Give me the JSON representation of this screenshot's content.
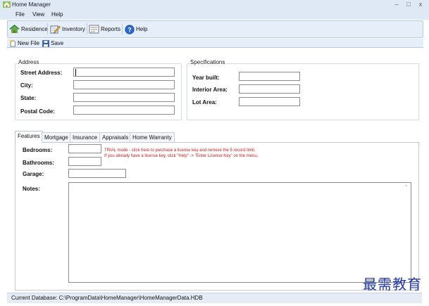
{
  "window": {
    "title": "Home Manager",
    "minimize_glyph": "–",
    "maximize_glyph": "□",
    "close_glyph": "x"
  },
  "menu": {
    "file": "File",
    "view": "View",
    "help": "Help"
  },
  "toolbar": {
    "residence": "Residence",
    "inventory": "Inventory",
    "reports": "Reports",
    "help": "Help"
  },
  "filebar": {
    "new_file": "New File",
    "save": "Save"
  },
  "address": {
    "group_title": "Address",
    "street_label": "Street Address:",
    "city_label": "City:",
    "state_label": "State:",
    "postal_label": "Postal Code:",
    "street_value": "",
    "city_value": "",
    "state_value": "",
    "postal_value": ""
  },
  "specifications": {
    "group_title": "Specifications",
    "year_label": "Year built:",
    "interior_label": "Interior Area:",
    "lot_label": "Lot Area:",
    "year_value": "",
    "interior_value": "",
    "lot_value": ""
  },
  "tabs": [
    {
      "label": "Features",
      "active": true
    },
    {
      "label": "Mortgage",
      "active": false
    },
    {
      "label": "Insurance",
      "active": false
    },
    {
      "label": "Appraisals",
      "active": false
    },
    {
      "label": "Home Warranty",
      "active": false
    }
  ],
  "features": {
    "bedrooms_label": "Bedrooms:",
    "bathrooms_label": "Bathrooms:",
    "garage_label": "Garage:",
    "notes_label": "Notes:",
    "bedrooms_value": "",
    "bathrooms_value": "",
    "garage_value": "",
    "notes_value": "",
    "trial_line1": "TRIAL mode -  click here to purchase a license key and remove the 5 record limit.",
    "trial_line2": "If you already have a license key, click \"Help\" -> \"Enter License Key\" on the menu."
  },
  "status": {
    "text": "Current Database: C:\\ProgramData\\HomeManager\\HomeManagerData.HDB"
  },
  "watermark": {
    "text": "最需教育"
  },
  "colors": {
    "chrome": "#dfe9f5",
    "toolbar": "#e6eef9",
    "trial_text": "#d01818",
    "watermark": "#243aa0"
  },
  "icons": {
    "app": "house-icon",
    "residence": "house-icon",
    "inventory": "pencil-edit-icon",
    "reports": "report-icon",
    "help": "help-circle-icon",
    "new_file": "new-file-icon",
    "save": "floppy-disk-icon"
  }
}
